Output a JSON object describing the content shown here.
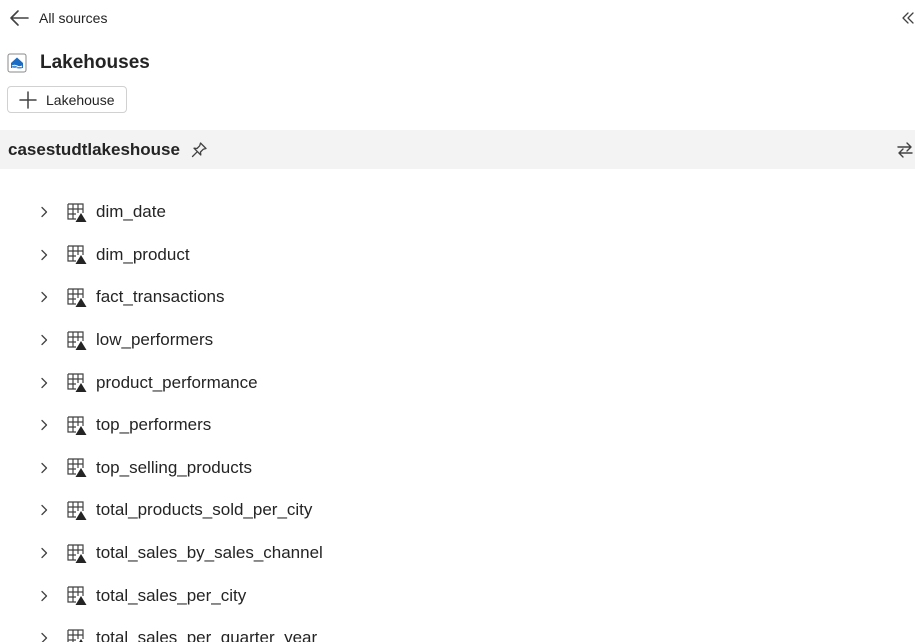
{
  "nav": {
    "back_label": "All sources"
  },
  "header": {
    "title": "Lakehouses",
    "add_button_label": "Lakehouse"
  },
  "lakehouse": {
    "name": "casestudtlakeshouse"
  },
  "tables": [
    {
      "name": "dim_date"
    },
    {
      "name": "dim_product"
    },
    {
      "name": "fact_transactions"
    },
    {
      "name": "low_performers"
    },
    {
      "name": "product_performance"
    },
    {
      "name": "top_performers"
    },
    {
      "name": "top_selling_products"
    },
    {
      "name": "total_products_sold_per_city"
    },
    {
      "name": "total_sales_by_sales_channel"
    },
    {
      "name": "total_sales_per_city"
    },
    {
      "name": "total_sales_per_quarter_year"
    }
  ],
  "icons": {
    "back": "arrow-left-icon",
    "collapse": "double-chevron-left-icon",
    "lakehouse": "lakehouse-icon",
    "add": "plus-icon",
    "pin": "pin-icon",
    "switch": "switch-arrows-icon",
    "expand": "chevron-right-icon",
    "table": "delta-table-icon"
  },
  "colors": {
    "bar_background": "#f3f3f3",
    "lakehouse_icon_blue": "#1a6bc4",
    "text": "#242424"
  }
}
